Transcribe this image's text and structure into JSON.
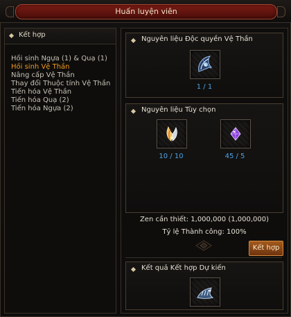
{
  "window": {
    "title": "Huấn luyện viên"
  },
  "left_panel": {
    "header": "Kết hợp",
    "items": [
      {
        "label": "Hồi sinh Ngựa (1) & Quạ (1)",
        "selected": false
      },
      {
        "label": "Hồi sinh Vệ Thần",
        "selected": true
      },
      {
        "label": "Nâng cấp Vệ Thần",
        "selected": false
      },
      {
        "label": "Thay đổi Thuộc tính Vệ Thần",
        "selected": false
      },
      {
        "label": "Tiến hóa Vệ Thần",
        "selected": false
      },
      {
        "label": "Tiến hóa Quạ (2)",
        "selected": false
      },
      {
        "label": "Tiến hóa Ngựa (2)",
        "selected": false
      }
    ]
  },
  "exclusive_materials": {
    "label": "Nguyên liệu Độc quyền Vệ Thần",
    "items": [
      {
        "icon": "guardian-wing-icon",
        "count": "1 / 1"
      }
    ]
  },
  "optional_materials": {
    "label": "Nguyên liệu Tùy chọn",
    "items": [
      {
        "icon": "fire-wing-icon",
        "count": "10 / 10"
      },
      {
        "icon": "purple-crystal-icon",
        "count": "45 / 5"
      }
    ]
  },
  "requirements": {
    "zen": "Zen cần thiết: 1,000,000 (1,000,000)",
    "success_rate": "Tỷ lệ Thành công: 100%"
  },
  "combine_button": "Kết hợp",
  "expected_result": {
    "label": "Kết quả Kết hợp Dự kiến",
    "icon": "guardian-pet-icon"
  },
  "colors": {
    "selected_item": "#f29a1e",
    "count_text": "#4fa3e8",
    "title_plate": "#6a1510",
    "button": "#8a4516"
  }
}
